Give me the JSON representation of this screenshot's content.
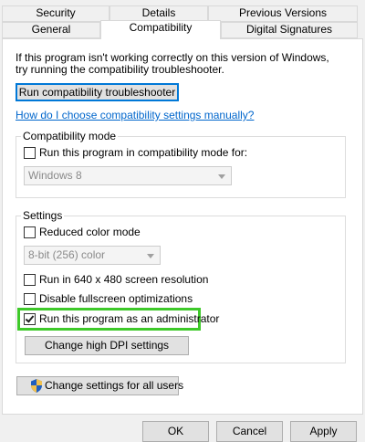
{
  "tabs": {
    "row1": [
      "Security",
      "Details",
      "Previous Versions"
    ],
    "row2": [
      "General",
      "Compatibility",
      "Digital Signatures"
    ],
    "active": "Compatibility"
  },
  "intro": {
    "line1": "If this program isn't working correctly on this version of Windows,",
    "line2": "try running the compatibility troubleshooter."
  },
  "troubleshooter_button": "Run compatibility troubleshooter",
  "manual_link": "How do I choose compatibility settings manually?",
  "compat_mode": {
    "title": "Compatibility mode",
    "checkbox_label": "Run this program in compatibility mode for:",
    "checked": false,
    "os_selected": "Windows 8"
  },
  "settings": {
    "title": "Settings",
    "reduced_color": {
      "label": "Reduced color mode",
      "checked": false
    },
    "color_selected": "8-bit (256) color",
    "res_640": {
      "label": "Run in 640 x 480 screen resolution",
      "checked": false
    },
    "fullscreen": {
      "label": "Disable fullscreen optimizations",
      "checked": false
    },
    "admin": {
      "label": "Run this program as an administrator",
      "checked": true
    },
    "dpi_button": "Change high DPI settings"
  },
  "all_users_button": "Change settings for all users",
  "footer": {
    "ok": "OK",
    "cancel": "Cancel",
    "apply": "Apply"
  },
  "colors": {
    "link": "#0066cc",
    "highlight": "#3ec92a",
    "focus": "#0078d7",
    "shield_blue": "#1f5fbf",
    "shield_yellow": "#f2c14e"
  }
}
